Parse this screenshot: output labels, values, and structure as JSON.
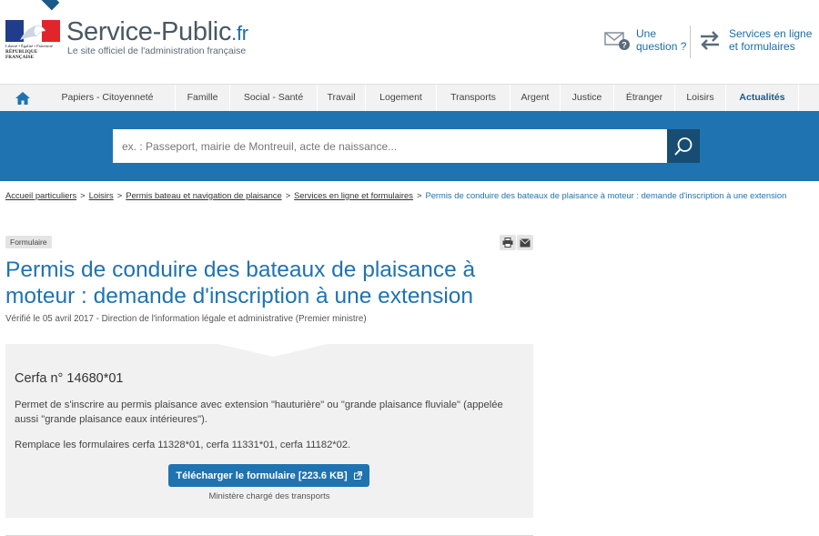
{
  "header": {
    "flag_lines": [
      "Liberté • Égalité • Fraternité",
      "RÉPUBLIQUE FRANÇAISE"
    ],
    "site_name": "Service-Public",
    "site_tld": ".fr",
    "tagline": "Le site officiel de l'administration française",
    "question_line1": "Une",
    "question_line2": "question ?",
    "services_line1": "Services en ligne",
    "services_line2": "et formulaires"
  },
  "nav": {
    "items": [
      "Papiers - Citoyenneté",
      "Famille",
      "Social - Santé",
      "Travail",
      "Logement",
      "Transports",
      "Argent",
      "Justice",
      "Étranger",
      "Loisirs",
      "Actualités"
    ]
  },
  "search": {
    "placeholder": "ex. : Passeport, mairie de Montreuil, acte de naissance..."
  },
  "breadcrumb": {
    "links": [
      "Accueil particuliers",
      "Loisirs",
      "Permis bateau et navigation de plaisance",
      "Services en ligne et formulaires"
    ],
    "separator": ">",
    "current": "Permis de conduire des bateaux de plaisance à moteur : demande d'inscription à une extension"
  },
  "page": {
    "badge": "Formulaire",
    "title": "Permis de conduire des bateaux de plaisance à moteur : demande d'inscription à une extension",
    "verified": "Vérifié le 05 avril 2017 - Direction de l'information légale et administrative (Premier ministre)"
  },
  "card": {
    "cerfa": "Cerfa n° 14680*01",
    "description": "Permet de s'inscrire au permis plaisance avec extension \"hauturière\" ou \"grande plaisance fluviale\" (appelée aussi \"grande plaisance eaux intérieures\").",
    "replace": "Remplace les formulaires cerfa 11328*01, cerfa 11331*01, cerfa 11182*02.",
    "download_label": "Télécharger le formulaire [223.6 KB]",
    "ministry": "Ministère chargé des transports"
  },
  "colors": {
    "primary": "#1f73b0",
    "dark": "#174d73",
    "nav_bg": "#f2f2f2",
    "card_bg": "#f1f1f1"
  },
  "icons": [
    "home-icon",
    "envelope-question-icon",
    "swap-arrows-icon",
    "search-icon",
    "print-icon",
    "mail-icon",
    "external-link-icon"
  ]
}
